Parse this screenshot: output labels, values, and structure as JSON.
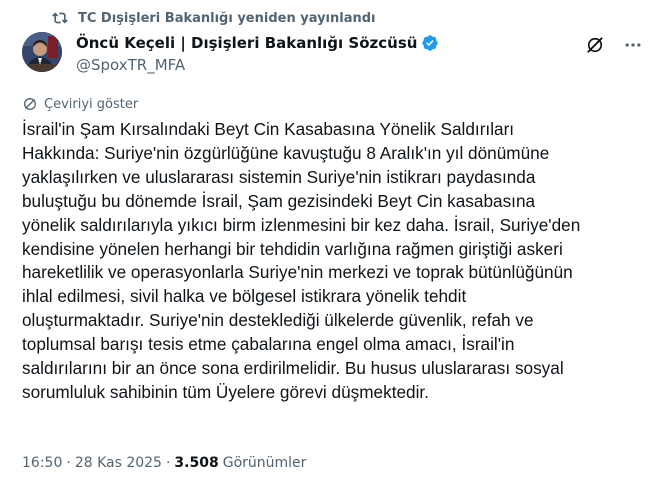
{
  "repost": {
    "label": "TC Dışişleri Bakanlığı yeniden yayınlandı",
    "icon": "repost-icon"
  },
  "author": {
    "display_name": "Öncü Keçeli | Dışişleri Bakanlığı Sözcüsü",
    "handle": "@SpoxTR_MFA",
    "verified_color": "#1d9bf0"
  },
  "actions": {
    "grok_icon": "grok-icon",
    "more_icon": "more-options-icon"
  },
  "translate": {
    "label": "Çeviriyi göster"
  },
  "tweet": {
    "text": "İsrail'in Şam Kırsalındaki Beyt Cin Kasabasına Yönelik Saldırıları\nHakkında: Suriye'nin özgürlüğüne kavuştuğu 8 Aralık'ın yıl dönümüne\nyaklaşılırken ve uluslararası sistemin Suriye'nin istikrarı paydasında\nbuluştuğu bu dönemde İsrail, Şam gezisindeki Beyt Cin kasabasına\nyönelik saldırılarıyla yıkıcı birm izlenmesini bir kez daha. İsrail, Suriye'den\nkendisine yönelen herhangi bir tehdidin varlığına rağmen giriştiği askeri\nhareketlilik ve operasyonlarla Suriye'nin merkezi ve toprak bütünlüğünün\nihlal edilmesi, sivil halka ve bölgesel istikrara yönelik tehdit\noluşturmaktadır. Suriye'nin desteklediği ülkelerde güvenlik, refah ve\ntoplumsal barışı tesis etme çabalarına engel olma amacı, İsrail'in\nsaldırılarını bir an önce sona erdirilmelidir. Bu husus uluslararası sosyal\nsorumluluk sahibinin tüm Üyelere görevi düşmektedir."
  },
  "meta": {
    "time": "16:50",
    "separator": "·",
    "date": "28 Kas 2025",
    "views_count": "3.508",
    "views_label": "Görünümler"
  }
}
